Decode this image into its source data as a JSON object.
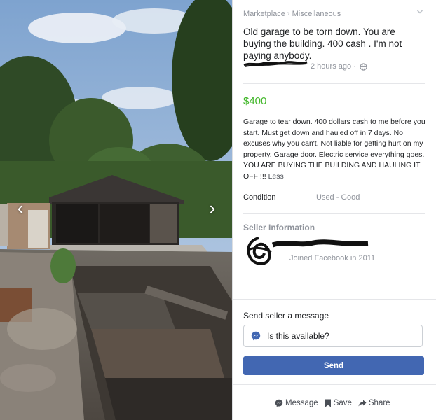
{
  "listing": {
    "breadcrumb": [
      "Marketplace",
      "Miscellaneous"
    ],
    "breadcrumb_sep": "›",
    "title": "Old garage to be torn down. You are buying the building. 400 cash . I'm not paying anybody.",
    "posted_ago": "2 hours ago ·",
    "price": "$400",
    "price_color": "#42b72a",
    "description": "Garage to tear down. 400 dollars cash to me before you start. Must get down and hauled off in 7 days. No excuses why you can't. Not liable for getting hurt on my property. Garage door.  Electric service everything goes. YOU ARE BUYING THE BUILDING AND HAULING IT OFF !!!",
    "less_link": "Less",
    "condition_label": "Condition",
    "condition_value": "Used - Good"
  },
  "seller": {
    "heading": "Seller Information",
    "joined": "Joined Facebook in 2011"
  },
  "message": {
    "heading": "Send seller a message",
    "value": "Is this available?",
    "send_label": "Send",
    "button_color": "#4267b2"
  },
  "actions": {
    "message_label": "Message",
    "save_label": "Save",
    "share_label": "Share"
  },
  "photo": {
    "prev_glyph": "‹",
    "next_glyph": "›"
  },
  "icons": {
    "expand": "chevron-down-icon",
    "privacy": "globe-icon",
    "messenger": "messenger-icon",
    "save": "bookmark-icon",
    "share": "share-arrow-icon"
  }
}
